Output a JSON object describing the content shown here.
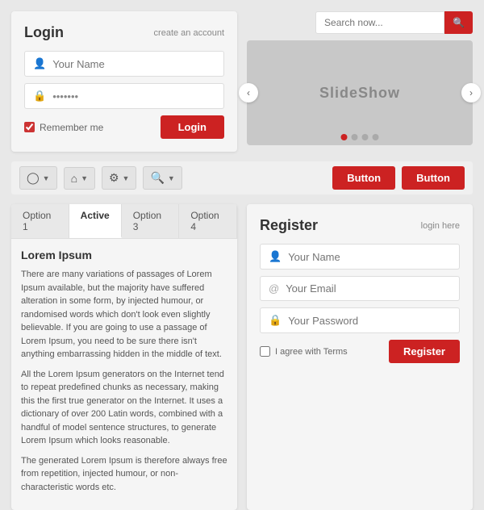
{
  "login": {
    "title": "Login",
    "create_account": "create an account",
    "name_placeholder": "Your Name",
    "password_placeholder": "●●●●●●●",
    "remember_label": "Remember me",
    "login_button": "Login"
  },
  "search": {
    "placeholder": "Search now..."
  },
  "slideshow": {
    "label": "SlideShow",
    "dots": [
      true,
      false,
      false,
      false
    ]
  },
  "nav": {
    "items": [
      {
        "icon": "👤",
        "label": "user-icon"
      },
      {
        "icon": "🏠",
        "label": "home-icon"
      },
      {
        "icon": "⚙",
        "label": "gear-icon"
      },
      {
        "icon": "🔍",
        "label": "search-icon"
      }
    ]
  },
  "buttons": {
    "btn1": "Button",
    "btn2": "Button"
  },
  "tabs": {
    "items": [
      "Option 1",
      "Active",
      "Option 3",
      "Option 4"
    ],
    "active_index": 1,
    "content_title": "Lorem Ipsum",
    "content_p1": "There are many variations of passages of Lorem Ipsum available, but the majority have suffered alteration in some form, by injected humour, or randomised words which don't look even slightly believable. If you are going to use a passage of Lorem Ipsum, you need to be sure there isn't anything embarrassing hidden in the middle of text.",
    "content_p2": "All the Lorem Ipsum generators on the Internet tend to repeat predefined chunks as necessary, making this the first true generator on the Internet. It uses a dictionary of over 200 Latin words, combined with a handful of model sentence structures, to generate Lorem Ipsum which looks reasonable.",
    "content_p3": "The generated Lorem Ipsum is therefore always free from repetition, injected humour, or non-characteristic words etc."
  },
  "register": {
    "title": "Register",
    "login_here": "login here",
    "name_placeholder": "Your Name",
    "email_placeholder": "Your Email",
    "password_placeholder": "Your Password",
    "agree_label": "I agree with Terms",
    "register_button": "Register"
  }
}
